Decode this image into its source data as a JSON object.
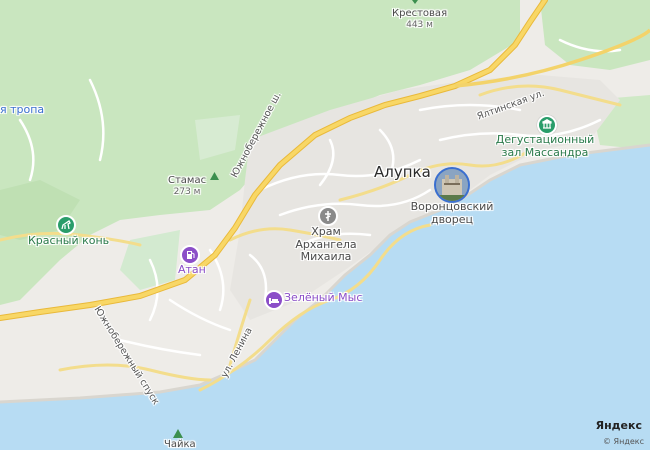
{
  "map": {
    "places": {
      "alupka": "Алупка",
      "krestovaya": "Крестовая",
      "krestovaya_height": "443 м",
      "stamas": "Стамас",
      "stamas_height": "273 м",
      "chayka": "Чайка"
    },
    "pois": {
      "khram": "Храм Архангела Михаила",
      "vorontsov": "Воронцовский дворец",
      "degust": "Дегустационный зал Массандра",
      "krasny_kon": "Красный конь",
      "atan": "Атан",
      "zeleny_mys": "Зелёный Мыс",
      "tropa": "я тропа"
    },
    "streets": {
      "yuzh_shosse": "Южнобережное ш.",
      "yalta_ul": "Ялтинская ул.",
      "yuzh_spusk": "Южнобережный спуск",
      "lenina": "ул. Ленина"
    },
    "attribution": {
      "brand": "Яндекс",
      "copyright": "© Яндекс"
    },
    "colors": {
      "sea": "#b7dcf3",
      "forest": "#c7e6bd",
      "urban": "#e9e7e3",
      "highway": "#f4c542",
      "road": "#f7e08a"
    }
  }
}
